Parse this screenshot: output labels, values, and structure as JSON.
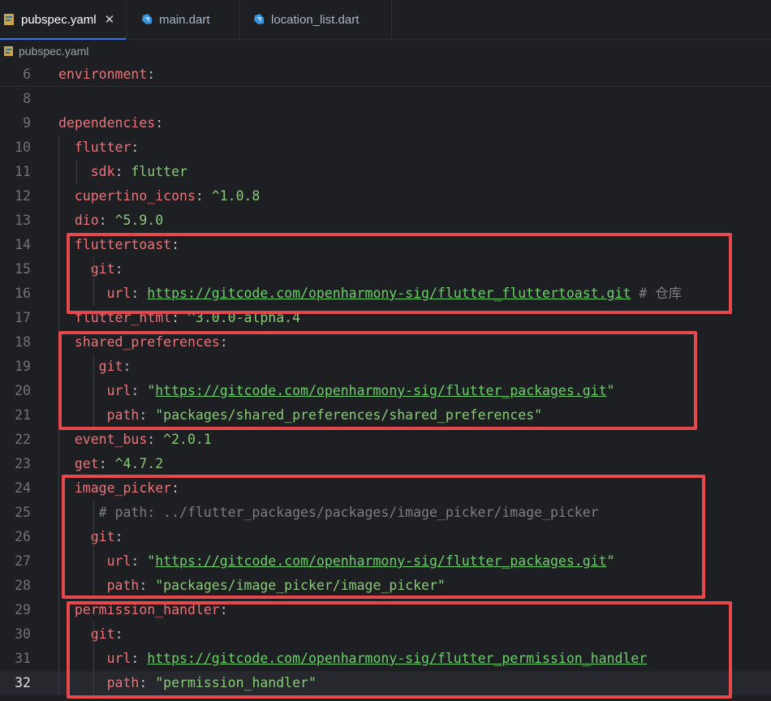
{
  "tabs": [
    {
      "label": "pubspec.yaml",
      "close": "✕"
    },
    {
      "label": "main.dart"
    },
    {
      "label": "location_list.dart"
    }
  ],
  "breadcrumb": "pubspec.yaml",
  "lines": [
    {
      "num": "6",
      "indent": "",
      "key": "environment",
      "colon": ":",
      "val": "",
      "url": "",
      "comment": ""
    },
    {
      "num": "8",
      "indent": "",
      "key": "",
      "colon": "",
      "val": "",
      "url": "",
      "comment": ""
    },
    {
      "num": "9",
      "indent": "",
      "key": "dependencies",
      "colon": ":",
      "val": "",
      "url": "",
      "comment": ""
    },
    {
      "num": "10",
      "indent": "  ",
      "key": "flutter",
      "colon": ":",
      "val": "",
      "url": "",
      "comment": ""
    },
    {
      "num": "11",
      "indent": "    ",
      "key": "sdk",
      "colon": ": ",
      "val": "flutter",
      "url": "",
      "comment": ""
    },
    {
      "num": "12",
      "indent": "  ",
      "key": "cupertino_icons",
      "colon": ": ",
      "val": "^1.0.8",
      "url": "",
      "comment": ""
    },
    {
      "num": "13",
      "indent": "  ",
      "key": "dio",
      "colon": ": ",
      "val": "^5.9.0",
      "url": "",
      "comment": ""
    },
    {
      "num": "14",
      "indent": "  ",
      "key": "fluttertoast",
      "colon": ":",
      "val": "",
      "url": "",
      "comment": ""
    },
    {
      "num": "15",
      "indent": "    ",
      "key": "git",
      "colon": ":",
      "val": "",
      "url": "",
      "comment": ""
    },
    {
      "num": "16",
      "indent": "      ",
      "key": "url",
      "colon": ": ",
      "val": "",
      "url": "https://gitcode.com/openharmony-sig/flutter_fluttertoast.git",
      "comment": " # 仓库"
    },
    {
      "num": "17",
      "indent": "  ",
      "key": "flutter_html",
      "colon": ": ",
      "val": "^3.0.0-alpha.4",
      "url": "",
      "comment": ""
    },
    {
      "num": "18",
      "indent": "  ",
      "key": "shared_preferences",
      "colon": ":",
      "val": "",
      "url": "",
      "comment": ""
    },
    {
      "num": "19",
      "indent": "     ",
      "key": "git",
      "colon": ":",
      "val": "",
      "url": "",
      "comment": ""
    },
    {
      "num": "20",
      "indent": "      ",
      "key": "url",
      "colon": ": ",
      "val": "\"",
      "url": "https://gitcode.com/openharmony-sig/flutter_packages.git",
      "tail": "\"",
      "comment": ""
    },
    {
      "num": "21",
      "indent": "      ",
      "key": "path",
      "colon": ": ",
      "val": "\"packages/shared_preferences/shared_preferences\"",
      "url": "",
      "comment": ""
    },
    {
      "num": "22",
      "indent": "  ",
      "key": "event_bus",
      "colon": ": ",
      "val": "^2.0.1",
      "url": "",
      "comment": ""
    },
    {
      "num": "23",
      "indent": "  ",
      "key": "get",
      "colon": ": ",
      "val": "^4.7.2",
      "url": "",
      "comment": ""
    },
    {
      "num": "24",
      "indent": "  ",
      "key": "image_picker",
      "colon": ":",
      "val": "",
      "url": "",
      "comment": ""
    },
    {
      "num": "25",
      "indent": "     ",
      "key": "",
      "colon": "",
      "val": "",
      "url": "",
      "comment": "# path: ../flutter_packages/packages/image_picker/image_picker"
    },
    {
      "num": "26",
      "indent": "    ",
      "key": "git",
      "colon": ":",
      "val": "",
      "url": "",
      "comment": ""
    },
    {
      "num": "27",
      "indent": "      ",
      "key": "url",
      "colon": ": ",
      "val": "\"",
      "url": "https://gitcode.com/openharmony-sig/flutter_packages.git",
      "tail": "\"",
      "comment": ""
    },
    {
      "num": "28",
      "indent": "      ",
      "key": "path",
      "colon": ": ",
      "val": "\"packages/image_picker/image_picker\"",
      "url": "",
      "comment": ""
    },
    {
      "num": "29",
      "indent": "  ",
      "key": "permission_handler",
      "colon": ":",
      "val": "",
      "url": "",
      "comment": ""
    },
    {
      "num": "30",
      "indent": "    ",
      "key": "git",
      "colon": ":",
      "val": "",
      "url": "",
      "comment": ""
    },
    {
      "num": "31",
      "indent": "      ",
      "key": "url",
      "colon": ": ",
      "val": "",
      "url": "https://gitcode.com/openharmony-sig/flutter_permission_handler",
      "comment": ""
    },
    {
      "num": "32",
      "indent": "      ",
      "key": "path",
      "colon": ": ",
      "val": "\"permission_handler\"",
      "url": "",
      "comment": ""
    }
  ],
  "colors": {
    "highlight_box": "#e5494e",
    "key": "#f07178",
    "string": "#89ca78",
    "comment": "#7a7e85"
  }
}
